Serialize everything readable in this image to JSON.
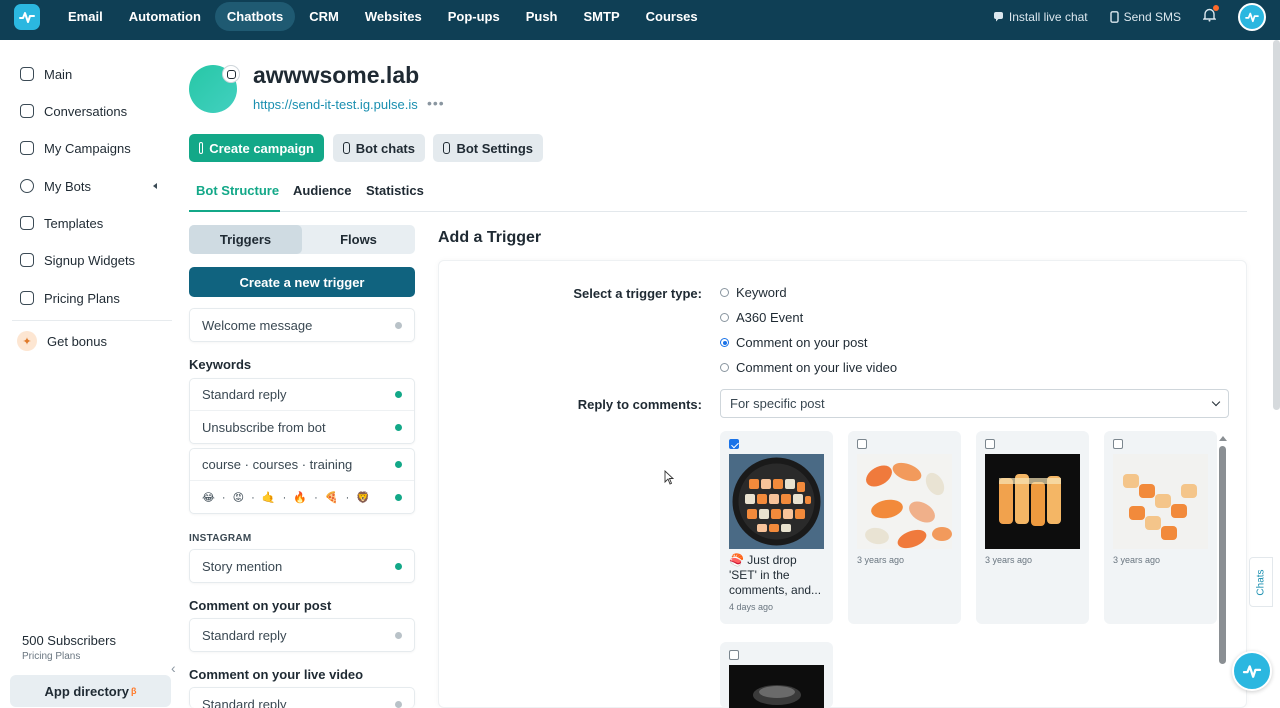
{
  "topnav": {
    "items": [
      "Email",
      "Automation",
      "Chatbots",
      "CRM",
      "Websites",
      "Pop-ups",
      "Push",
      "SMTP",
      "Courses"
    ],
    "active": "Chatbots",
    "install_live_chat": "Install live chat",
    "send_sms": "Send SMS"
  },
  "sidebar": {
    "items": [
      "Main",
      "Conversations",
      "My Campaigns",
      "My Bots",
      "Templates",
      "Signup Widgets",
      "Pricing Plans"
    ],
    "bonus": "Get bonus",
    "subscribers": "500 Subscribers",
    "pricing_link": "Pricing Plans",
    "app_directory": "App directory",
    "app_directory_badge": "β"
  },
  "bot": {
    "name": "awwwsome.lab",
    "url": "https://send-it-test.ig.pulse.is",
    "more": "•••"
  },
  "actions": {
    "create_campaign": "Create campaign",
    "bot_chats": "Bot chats",
    "bot_settings": "Bot Settings"
  },
  "tabs": [
    "Bot Structure",
    "Audience",
    "Statistics"
  ],
  "left_panel": {
    "segments": [
      "Triggers",
      "Flows"
    ],
    "create_trigger": "Create a new trigger",
    "welcome": "Welcome message",
    "keywords_title": "Keywords",
    "keywords": [
      "Standard reply",
      "Unsubscribe from bot",
      "course · courses · training",
      "😂 · 😡 · 🤙 · 🔥 · 🍕 · 🦁"
    ],
    "instagram_title": "INSTAGRAM",
    "story_mention": "Story mention",
    "comment_post_title": "Comment on your post",
    "comment_post_reply": "Standard reply",
    "comment_live_title": "Comment on your live video",
    "comment_live_reply": "Standard reply"
  },
  "trigger": {
    "title": "Add a Trigger",
    "type_label": "Select a trigger type:",
    "options": [
      "Keyword",
      "A360 Event",
      "Comment on your post",
      "Comment on your live video"
    ],
    "selected": "Comment on your post",
    "reply_label": "Reply to comments:",
    "reply_value": "For specific post",
    "posts": [
      {
        "checked": true,
        "caption": "🍣 Just drop 'SET' in the comments, and...",
        "age": "4 days ago"
      },
      {
        "checked": false,
        "caption": "",
        "age": "3 years ago"
      },
      {
        "checked": false,
        "caption": "",
        "age": "3 years ago"
      },
      {
        "checked": false,
        "caption": "",
        "age": "3 years ago"
      },
      {
        "checked": false,
        "caption": "",
        "age": ""
      }
    ]
  },
  "chats_tab": "Chats",
  "colors": {
    "topbar": "#0f3f55",
    "accent": "#13a888",
    "primary_dark": "#10637f",
    "brand": "#2bb7e0"
  }
}
